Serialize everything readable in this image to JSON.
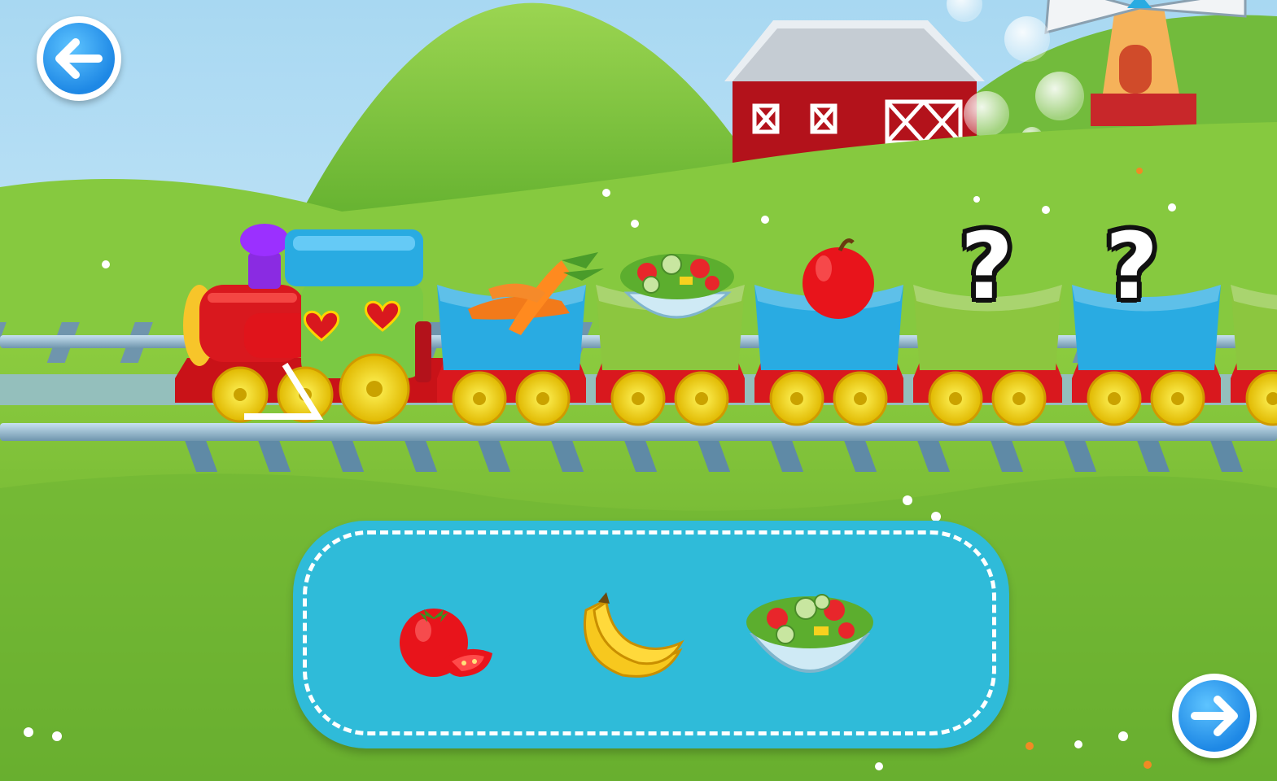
{
  "colors": {
    "sky": "#bfe5f7",
    "hill": "#8fd34a",
    "grass": "#7cc33a",
    "rail": "#8fb5cd",
    "tray": "#2fbbd9",
    "nav_button": "#1e88e5",
    "loco_body": "#d9181e",
    "loco_cab": "#7ac943",
    "loco_roof": "#29abe2",
    "car_blue": "#29abe2",
    "car_green": "#8cc63f",
    "wheel": "#f5e100"
  },
  "navigation": {
    "back_icon": "arrow-left-icon",
    "next_icon": "arrow-right-icon"
  },
  "train": {
    "locomotive": "steam-engine",
    "cars": [
      {
        "color": "blue",
        "cargo": "carrots",
        "state": "filled"
      },
      {
        "color": "green",
        "cargo": "salad-bowl",
        "state": "filled"
      },
      {
        "color": "blue",
        "cargo": "apple",
        "state": "filled"
      },
      {
        "color": "green",
        "cargo": "?",
        "state": "unknown"
      },
      {
        "color": "blue",
        "cargo": "?",
        "state": "unknown"
      },
      {
        "color": "green",
        "cargo": "",
        "state": "partial"
      }
    ]
  },
  "choices": [
    {
      "item": "tomato"
    },
    {
      "item": "banana"
    },
    {
      "item": "salad-bowl"
    }
  ],
  "background": {
    "elements": [
      "green-hills",
      "red-barn",
      "windmill",
      "bubbles",
      "railway-track",
      "flowers"
    ]
  }
}
